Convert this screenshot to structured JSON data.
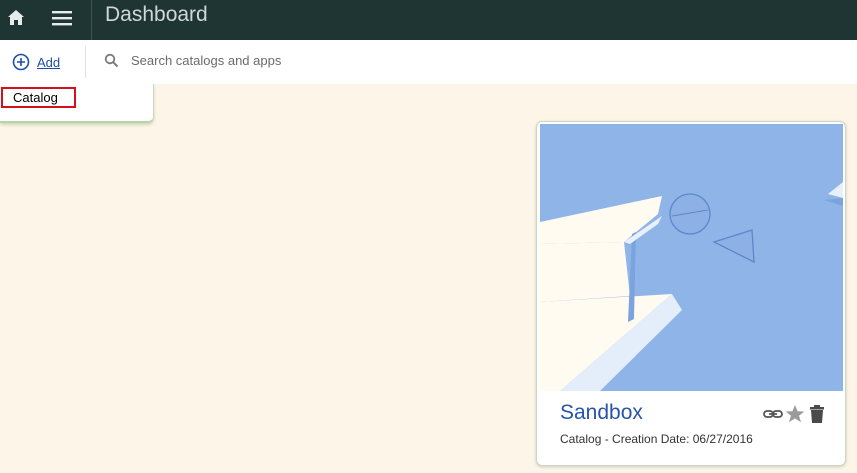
{
  "header": {
    "title": "Dashboard",
    "home_icon": "home-icon",
    "menu_icon": "hamburger-menu-icon",
    "background": "#1f3534"
  },
  "toolbar": {
    "add_label": "Add",
    "add_icon": "plus-circle-icon",
    "search_placeholder": "Search catalogs and apps",
    "search_value": ""
  },
  "add_menu": {
    "items": [
      {
        "label": "Catalog",
        "highlighted": true
      }
    ]
  },
  "cards": [
    {
      "name": "Sandbox",
      "subtitle": "Catalog - Creation Date: 06/27/2016",
      "actions": [
        "link-icon",
        "star-icon",
        "trash-icon"
      ]
    }
  ],
  "colors": {
    "accent": "#2754a8",
    "page_background": "#fdf6e8",
    "highlight_border": "#d0121f"
  }
}
